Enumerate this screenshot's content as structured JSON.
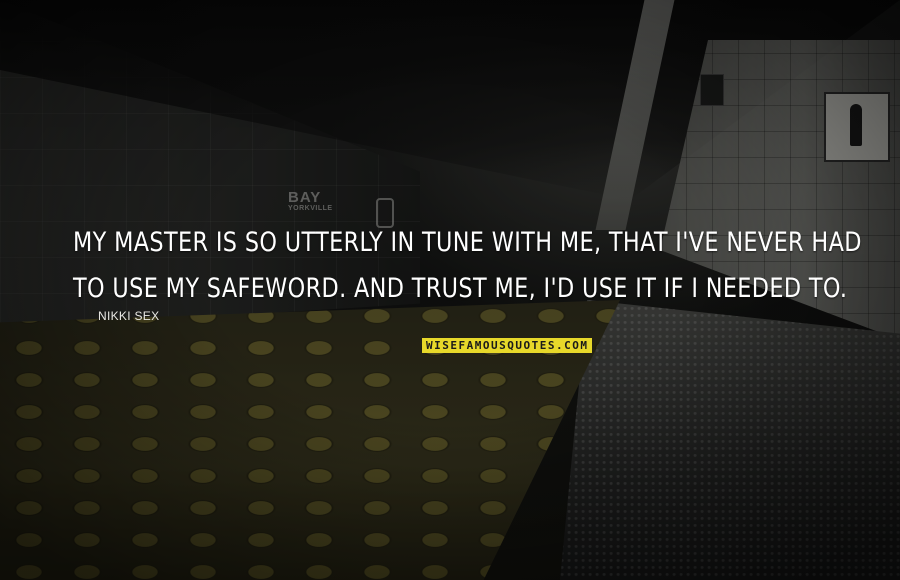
{
  "background": {
    "description_icon": "subway-platform-photo",
    "station_sign_name": "BAY",
    "station_sign_sub": "YORKVILLE"
  },
  "quote": {
    "lines": [
      "MY MASTER IS SO UTTERLY IN TUNE WITH ME, THAT I'VE NEVER HAD",
      "TO USE MY SAFEWORD. AND TRUST ME, I'D USE IT IF I NEEDED TO."
    ],
    "author": "NIKKI SEX"
  },
  "watermark": {
    "text": "WISEFAMOUSQUOTES.COM",
    "color": "#e7d82a"
  },
  "colors": {
    "text": "#ffffff",
    "accent": "#e7d82a"
  }
}
